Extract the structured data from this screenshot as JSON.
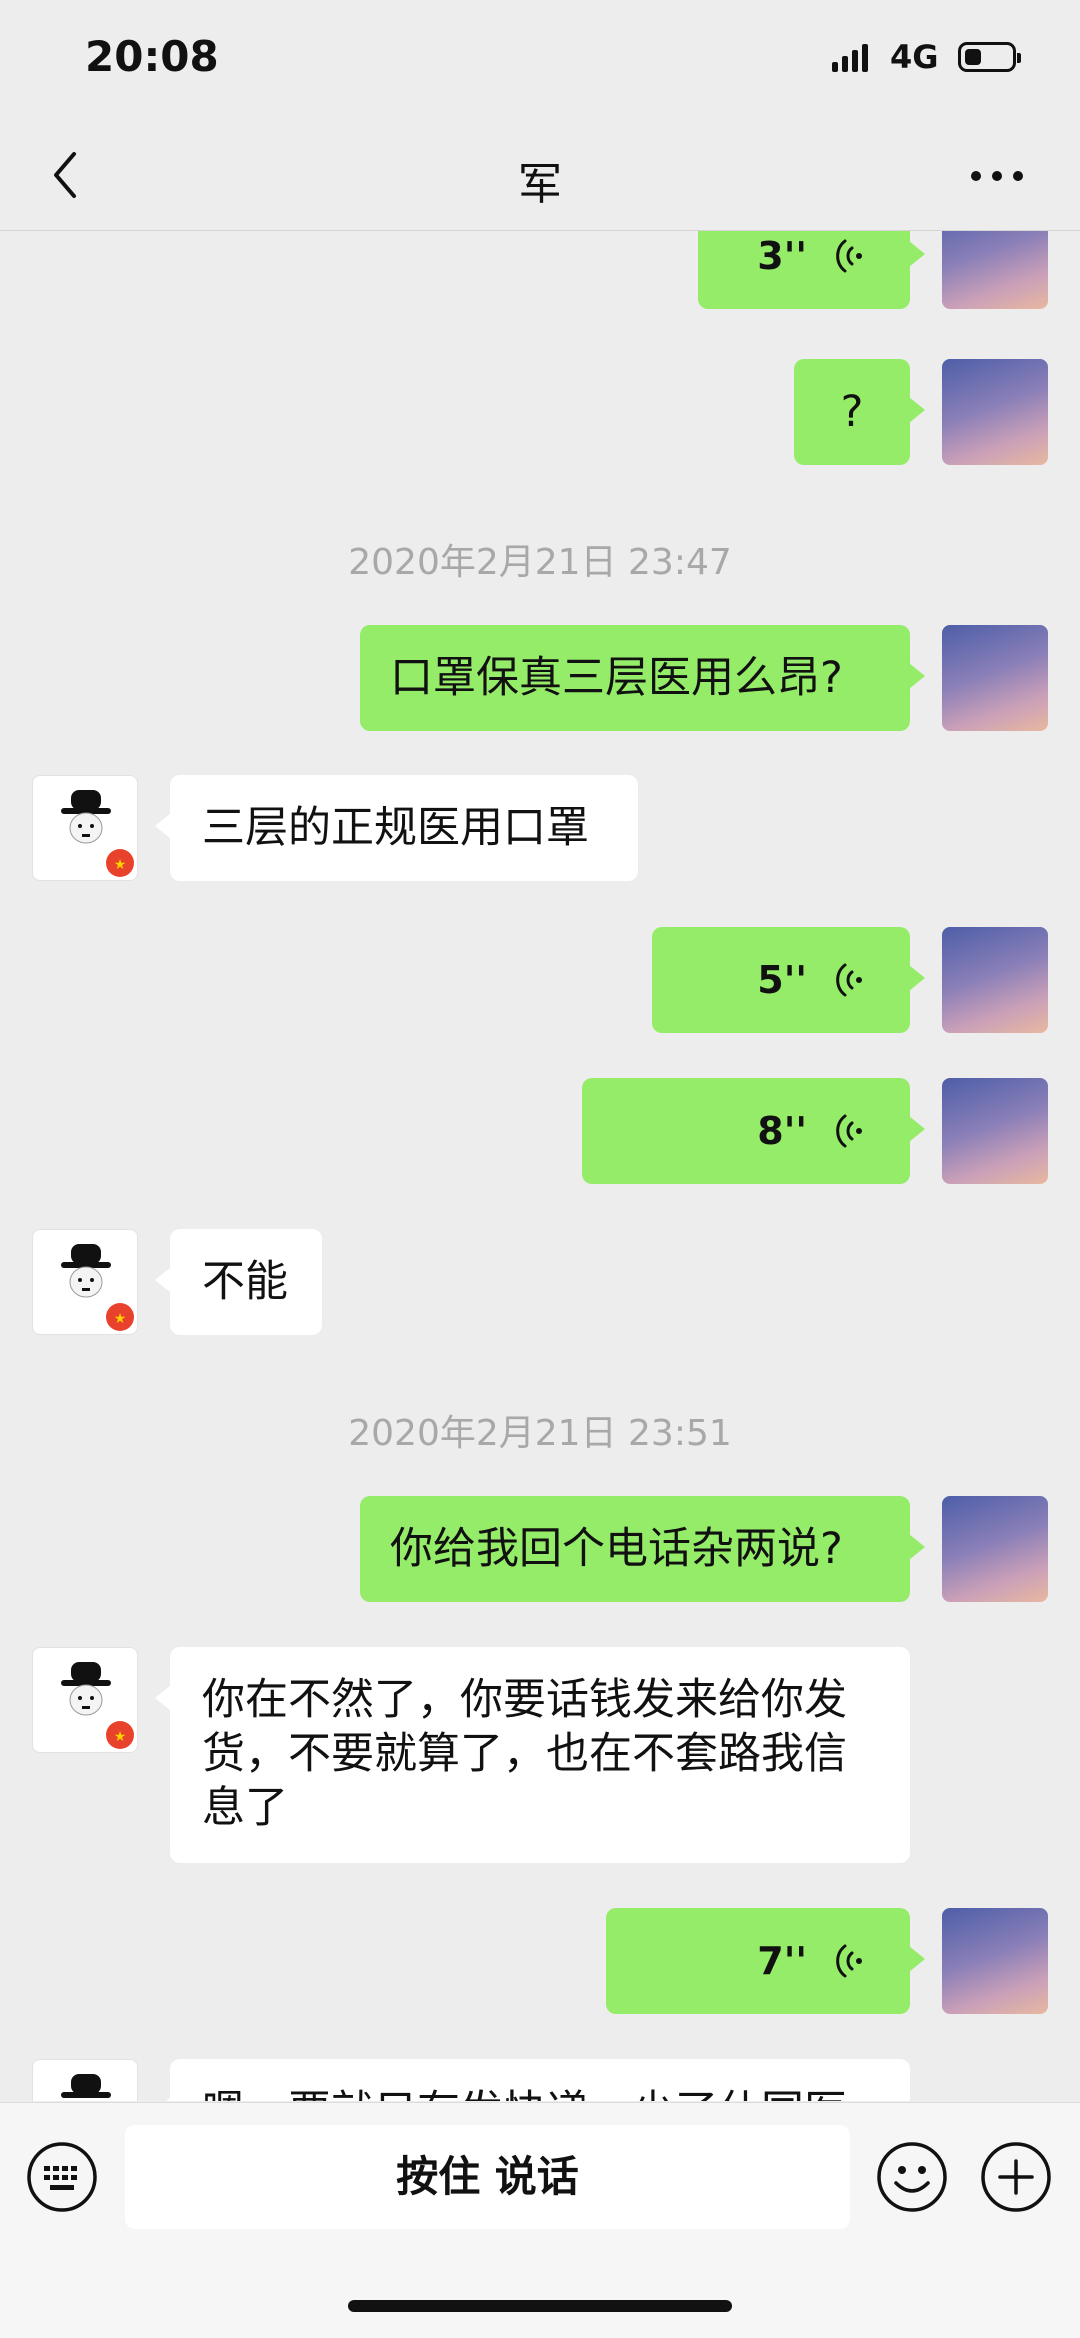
{
  "status_bar": {
    "time": "20:08",
    "network": "4G",
    "battery_level": 0.35
  },
  "header": {
    "back_icon": "chevron-left-icon",
    "title": "军",
    "more_icon": "more-horizontal-icon"
  },
  "timestamps": [
    "2020年2月21日 23:47",
    "2020年2月21日 23:51"
  ],
  "messages": [
    {
      "side": "self",
      "type": "voice",
      "duration": "3''"
    },
    {
      "side": "self",
      "type": "text",
      "text": "?"
    },
    {
      "side": "self",
      "type": "text",
      "text": "口罩保真三层医用么昂?"
    },
    {
      "side": "other",
      "type": "text",
      "text": "三层的正规医用口罩"
    },
    {
      "side": "self",
      "type": "voice",
      "duration": "5''"
    },
    {
      "side": "self",
      "type": "voice",
      "duration": "8''"
    },
    {
      "side": "other",
      "type": "text",
      "text": "不能"
    },
    {
      "side": "self",
      "type": "text",
      "text": "你给我回个电话杂两说?"
    },
    {
      "side": "other",
      "type": "text",
      "text": "你在不然了，你要话钱发来给你发货，不要就算了，也在不套路我信息了"
    },
    {
      "side": "self",
      "type": "voice",
      "duration": "7''"
    },
    {
      "side": "other",
      "type": "text",
      "text": "嗯，要就只有发快递，少了仕国医"
    }
  ],
  "input_bar": {
    "keyboard_icon": "keyboard-icon",
    "hold_to_talk_label": "按住 说话",
    "emoji_icon": "emoji-icon",
    "plus_icon": "plus-circle-icon"
  },
  "colors": {
    "self_bubble": "#95ec69",
    "other_bubble": "#ffffff",
    "background": "#ededed",
    "timestamp": "#a8a8a8"
  }
}
